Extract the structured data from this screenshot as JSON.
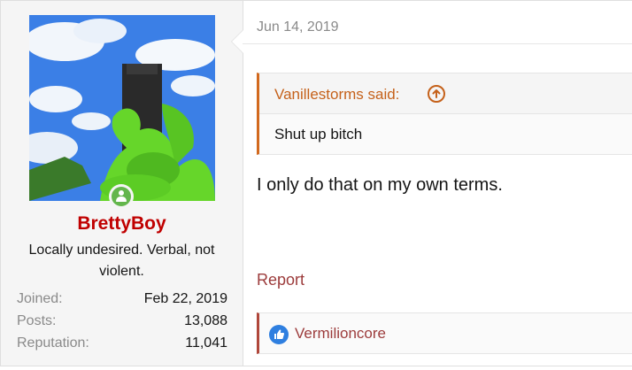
{
  "post": {
    "date": "Jun 14, 2019",
    "message": "I only do that on my own terms.",
    "report_label": "Report"
  },
  "user": {
    "name": "BrettyBoy",
    "title": "Locally undesired. Verbal, not violent.",
    "stats": [
      {
        "label": "Joined:",
        "value": "Feb 22, 2019"
      },
      {
        "label": "Posts:",
        "value": "13,088"
      },
      {
        "label": "Reputation:",
        "value": "11,041"
      }
    ],
    "online_icon": "online-user-icon"
  },
  "quote": {
    "author": "Vanillestorms said:",
    "text": "Shut up bitch",
    "jump_icon": "arrow-up-circle-icon"
  },
  "reactions": {
    "icon": "like-thumb-icon",
    "users": "Vermilioncore"
  },
  "colors": {
    "username": "#c00000",
    "quote_accent": "#d2691e",
    "link": "#9c3b3b",
    "like": "#2f7fe0",
    "online": "#63b64c"
  }
}
